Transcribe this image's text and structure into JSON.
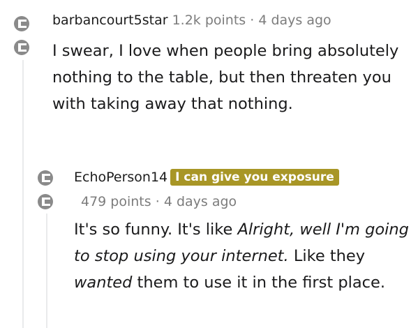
{
  "comments": [
    {
      "author": "barbancourt5star",
      "points": "1.2k points",
      "separator": "·",
      "time": "4 days ago",
      "body": "I swear, I love when people bring absolutely nothing to the table, but then threaten you with taking away that nothing."
    },
    {
      "author": "EchoPerson14",
      "flair": "I can give you exposure",
      "points": "479 points",
      "separator": "·",
      "time": "4 days ago",
      "body_parts": [
        "It's so funny. It's like ",
        "Alright, well I'm going to stop using your internet.",
        " Like they ",
        "wanted",
        " them to use it in the first place."
      ]
    }
  ],
  "colors": {
    "flair_background": "#a89626",
    "muted_text": "#7c7c7c",
    "thread_line": "#e9eaeb",
    "avatar_gray": "#8a8a8a"
  },
  "icons": [
    "collapse-avatar-icon"
  ]
}
